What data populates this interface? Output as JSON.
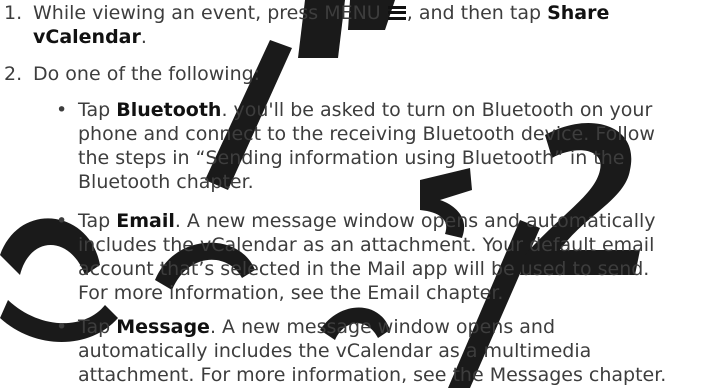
{
  "steps": [
    {
      "num": "1.",
      "line1_a": "While viewing an event, press MENU ",
      "line1_b": ", and then tap ",
      "line1_bold": "Share",
      "line2_bold": "vCalendar",
      "line2_end": "."
    },
    {
      "num": "2.",
      "text": "Do one of the following:"
    }
  ],
  "bullets": [
    {
      "bold": "Bluetooth",
      "line1": ". you'll be asked to turn on Bluetooth on your",
      "lines": [
        "phone and connect to the receiving Bluetooth device. Follow",
        "the steps in “Sending information using Bluetooth” in the",
        "Bluetooth chapter."
      ]
    },
    {
      "bold": "Email",
      "line1": ". A new message window opens and automatically",
      "lines": [
        "includes the vCalendar as an attachment. Your default email",
        "account that’s selected in the Mail app will be used to send.",
        "For more information, see the Email chapter."
      ]
    },
    {
      "bold": "Message",
      "line1": ". A new message window opens and",
      "lines": [
        "automatically includes the vCalendar as a multimedia",
        "attachment. For more information, see the Messages chapter."
      ]
    }
  ],
  "tap_word": "Tap ",
  "bullet_symbol": "•",
  "icons": {
    "menu": "menu-icon"
  },
  "colors": {
    "text": "#3d3d3d",
    "bold": "#111111",
    "watermark": "#1a1a1a"
  }
}
